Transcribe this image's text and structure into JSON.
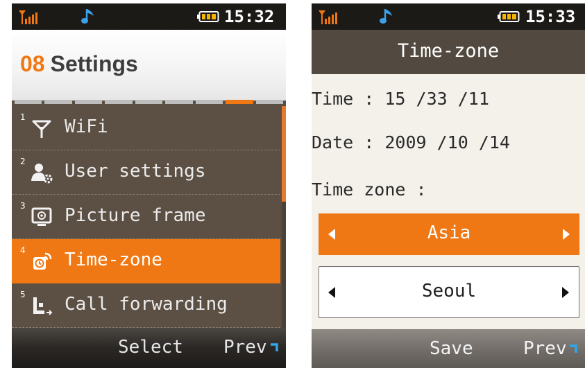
{
  "left_screen": {
    "status": {
      "time": "15:32"
    },
    "header": {
      "number": "08",
      "title": "Settings"
    },
    "page_indicator": {
      "total": 9,
      "active_index": 7
    },
    "menu": [
      {
        "num": "1",
        "label": "WiFi",
        "icon": "antenna-icon"
      },
      {
        "num": "2",
        "label": "User settings",
        "icon": "user-settings-icon"
      },
      {
        "num": "3",
        "label": "Picture frame",
        "icon": "picture-frame-icon"
      },
      {
        "num": "4",
        "label": "Time-zone",
        "icon": "time-zone-icon",
        "selected": true
      },
      {
        "num": "5",
        "label": "Call forwarding",
        "icon": "call-forwarding-icon"
      }
    ],
    "softkeys": {
      "left": "Select",
      "right": "Prev"
    }
  },
  "right_screen": {
    "status": {
      "time": "15:33"
    },
    "title": "Time-zone",
    "time_line": "Time : 15 /33 /11",
    "date_line": "Date : 2009 /10 /14",
    "zone_label": "Time zone :",
    "region": "Asia",
    "city": "Seoul",
    "softkeys": {
      "left": "Save",
      "right": "Prev"
    }
  },
  "colors": {
    "accent": "#f07814",
    "menu_bg": "#5c5044",
    "status_bar": "#1c1a17"
  }
}
